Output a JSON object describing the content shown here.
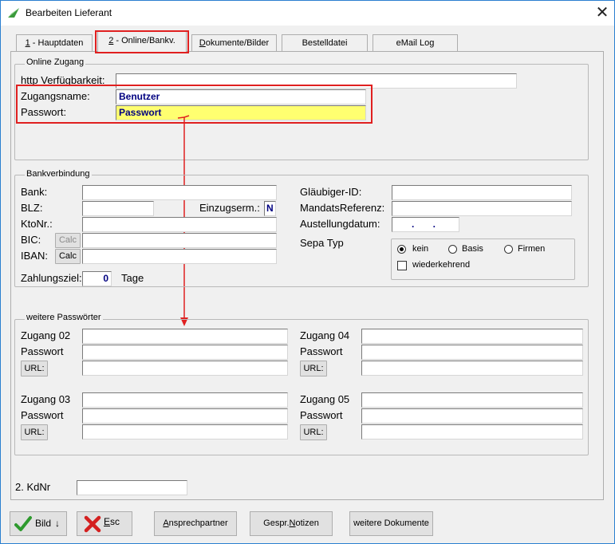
{
  "window": {
    "title": "Bearbeiten Lieferant",
    "close_glyph": "✕"
  },
  "tabs": [
    {
      "prefix": "1",
      "label": " - Hauptdaten"
    },
    {
      "prefix": "2",
      "label": " - Online/Bankv."
    },
    {
      "prefix": "D",
      "label": "okumente/Bilder"
    },
    {
      "prefix": "",
      "label": "Bestelldatei"
    },
    {
      "prefix": "",
      "label": "eMail Log"
    }
  ],
  "online_zugang": {
    "title": "Online Zugang",
    "http_label": "http Verfügbarkeit:",
    "http_value": "",
    "zugangsname_label": "Zugangsname:",
    "zugangsname_value": "Benutzer",
    "passwort_label": "Passwort:",
    "passwort_value": "Passwort"
  },
  "bankverbindung": {
    "title": "Bankverbindung",
    "bank_label": "Bank:",
    "blz_label": "BLZ:",
    "einzug_label": "Einzugserm.:",
    "einzug_value": "N",
    "ktonr_label": "KtoNr.:",
    "bic_label": "BIC:",
    "iban_label": "IBAN:",
    "calc_label": "Calc",
    "zahlungsziel_label": "Zahlungsziel:",
    "zahlungsziel_value": "0",
    "tage_label": "Tage",
    "glaeubiger_label": "Gläubiger-ID:",
    "mandat_label": "MandatsReferenz:",
    "austellung_label": "Austellungdatum:",
    "austellung_value": ". .",
    "sepa_label": "Sepa Typ",
    "sepa_options": [
      "kein",
      "Basis",
      "Firmen"
    ],
    "sepa_selected": "kein",
    "wiederkehrend_label": "wiederkehrend",
    "wiederkehrend_checked": false
  },
  "weitere": {
    "title": "weitere Passwörter",
    "passwort_label": "Passwort",
    "url_label": "URL:",
    "zugang02": "Zugang 02",
    "zugang03": "Zugang 03",
    "zugang04": "Zugang 04",
    "zugang05": "Zugang 05"
  },
  "kdnr": {
    "label": "2. KdNr",
    "value": ""
  },
  "footer": {
    "bild_label": "Bild",
    "esc_label": "sc",
    "esc_prefix": "E",
    "ansprech_prefix": "A",
    "ansprech_label": "nsprechpartner",
    "gespr_label_a": "Gespr.",
    "gespr_label_n": "N",
    "gespr_label_b": "otizen",
    "weitere_label": "weitere Dokumente"
  }
}
